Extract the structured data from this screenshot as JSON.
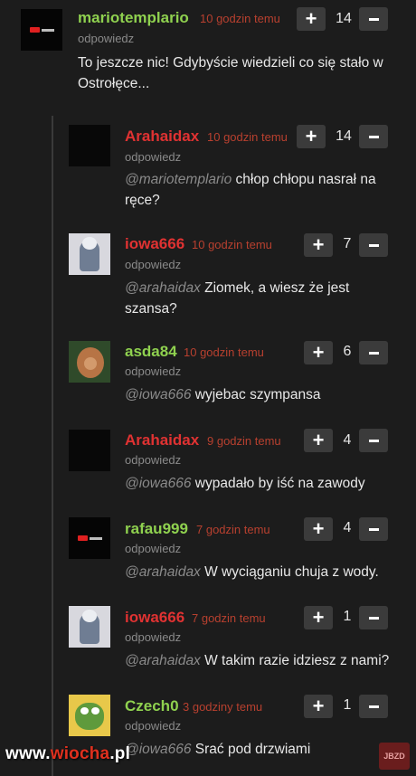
{
  "comments": [
    {
      "username": "mariotemplario",
      "time": "10 godzin temu",
      "reply": "odpowiedz",
      "mention": "",
      "text": "To jeszcze nic! Gdybyście wiedzieli co się stało w Ostrołęce...",
      "votes": "14",
      "name_color": "green",
      "avatar": "logo"
    },
    {
      "username": "Arahaidax",
      "time": "10 godzin temu",
      "reply": "odpowiedz",
      "mention": "@mariotemplario",
      "text": " chłop chłopu nasrał na ręce?",
      "votes": "14",
      "name_color": "red",
      "avatar": "black"
    },
    {
      "username": "iowa666",
      "time": "10 godzin temu",
      "reply": "odpowiedz",
      "mention": "@arahaidax",
      "text": " Ziomek, a wiesz że jest szansa?",
      "votes": "7",
      "name_color": "red",
      "avatar": "photo"
    },
    {
      "username": "asda84",
      "time": "10 godzin temu",
      "reply": "odpowiedz",
      "mention": "@iowa666",
      "text": " wyjebac szympansa",
      "votes": "6",
      "name_color": "green",
      "avatar": "monkey"
    },
    {
      "username": "Arahaidax",
      "time": "9 godzin temu",
      "reply": "odpowiedz",
      "mention": "@iowa666",
      "text": " wypadało by iść na zawody",
      "votes": "4",
      "name_color": "red",
      "avatar": "black"
    },
    {
      "username": "rafau999",
      "time": "7 godzin temu",
      "reply": "odpowiedz",
      "mention": "@arahaidax",
      "text": " W wyciąganiu chuja z wody.",
      "votes": "4",
      "name_color": "green",
      "avatar": "logo"
    },
    {
      "username": "iowa666",
      "time": "7 godzin temu",
      "reply": "odpowiedz",
      "mention": "@arahaidax",
      "text": " W takim razie idziesz z nami?",
      "votes": "1",
      "name_color": "red",
      "avatar": "photo"
    },
    {
      "username": "Czech0",
      "time": "3 godziny temu",
      "reply": "odpowiedz",
      "mention": "@iowa666",
      "text": " Srać pod drzwiami",
      "votes": "1",
      "name_color": "green",
      "avatar": "pepe"
    }
  ],
  "watermark": {
    "prefix": "www.",
    "brand": "wiocha",
    "suffix": ".pl"
  },
  "jbzd_badge": "JBZD",
  "colors": {
    "background": "#1c1c1c",
    "green_name": "#8fd14f",
    "red_name": "#e03232",
    "time": "#b8402f",
    "vote_button": "#3b3b3b"
  }
}
